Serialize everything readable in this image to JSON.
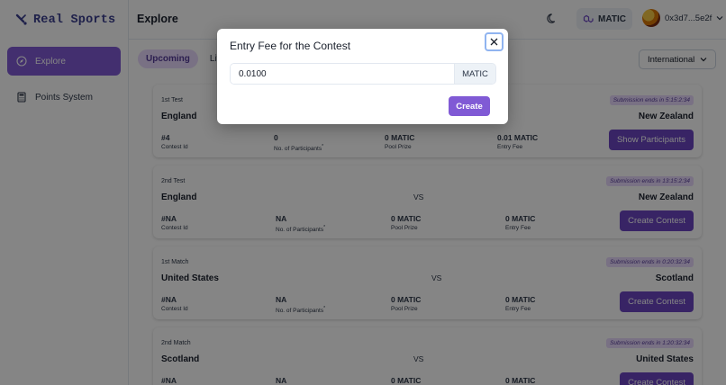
{
  "app": {
    "logo_text": "Real Sports"
  },
  "sidebar": {
    "items": [
      {
        "label": "Explore",
        "icon": "compass-icon",
        "active": true
      },
      {
        "label": "Points System",
        "icon": "calculator-icon",
        "active": false
      }
    ]
  },
  "header": {
    "title": "Explore",
    "chain_label": "MATIC",
    "wallet_address": "0x3d7...5e2f"
  },
  "tabs": [
    {
      "label": "Upcoming",
      "selected": true
    },
    {
      "label": "Live",
      "selected": false
    }
  ],
  "filter": {
    "selected": "International"
  },
  "cards": [
    {
      "label": "1st Test",
      "badge": "Submission ends in 5:15:2:34",
      "team1": "England",
      "vs": "",
      "team2": "New Zealand",
      "contest_id": "#4",
      "participants": "0",
      "pool_prize": "0 MATIC",
      "entry_fee": "0.01 MATIC",
      "button": "Show Participants"
    },
    {
      "label": "2nd Test",
      "badge": "Submission ends in 13:15:2:34",
      "team1": "England",
      "vs": "VS",
      "team2": "New Zealand",
      "contest_id": "#NA",
      "participants": "NA",
      "pool_prize": "0 MATIC",
      "entry_fee": "0 MATIC",
      "button": "Create Contest"
    },
    {
      "label": "1st Match",
      "badge": "Submission ends in 0:20:32:34",
      "team1": "United States",
      "vs": "VS",
      "team2": "Scotland",
      "contest_id": "#NA",
      "participants": "NA",
      "pool_prize": "0 MATIC",
      "entry_fee": "0 MATIC",
      "button": "Create Contest"
    },
    {
      "label": "2nd Match",
      "badge": "Submission ends in 1:20:32:34",
      "team1": "Scotland",
      "vs": "VS",
      "team2": "United States",
      "contest_id": "#NA",
      "participants": "NA",
      "pool_prize": "0 MATIC",
      "entry_fee": "0 MATIC",
      "button": "Create Contest"
    }
  ],
  "stat_labels": {
    "contest_id": "Contest Id",
    "participants": "No. of Participants",
    "participants_mark": "*",
    "pool_prize": "Pool Prize",
    "entry_fee": "Entry Fee"
  },
  "modal": {
    "title": "Entry Fee for the Contest",
    "fee_value": "0.0100",
    "fee_unit": "MATIC",
    "create_label": "Create"
  },
  "colors": {
    "accent": "#805ad5",
    "button": "#6b46c1",
    "badge_bg": "#e9d8fd"
  }
}
